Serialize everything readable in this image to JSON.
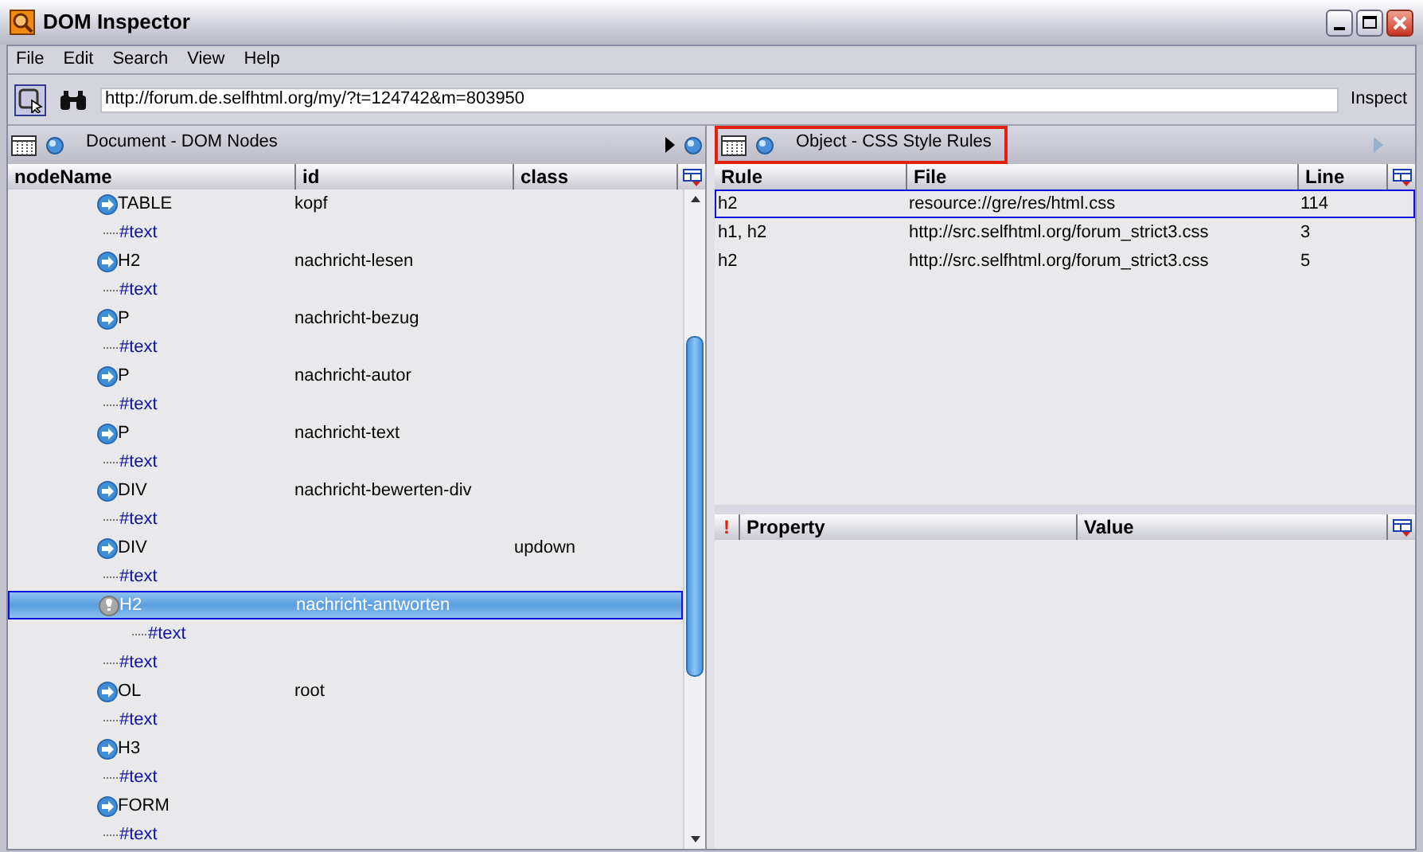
{
  "window": {
    "title": "DOM Inspector"
  },
  "menu": [
    "File",
    "Edit",
    "Search",
    "View",
    "Help"
  ],
  "toolbar": {
    "url": "http://forum.de.selfhtml.org/my/?t=124742&m=803950",
    "inspect_label": "Inspect"
  },
  "left_panel": {
    "title": "Document - DOM Nodes",
    "columns": [
      "nodeName",
      "id",
      "class"
    ],
    "nodes": [
      {
        "kind": "element",
        "name": "TABLE",
        "id": "kopf",
        "selected": false
      },
      {
        "kind": "text",
        "name": "#text",
        "selected": false
      },
      {
        "kind": "element",
        "name": "H2",
        "id": "nachricht-lesen",
        "selected": false
      },
      {
        "kind": "text",
        "name": "#text",
        "selected": false
      },
      {
        "kind": "element",
        "name": "P",
        "id": "nachricht-bezug",
        "selected": false
      },
      {
        "kind": "text",
        "name": "#text",
        "selected": false
      },
      {
        "kind": "element",
        "name": "P",
        "id": "nachricht-autor",
        "selected": false
      },
      {
        "kind": "text",
        "name": "#text",
        "selected": false
      },
      {
        "kind": "element",
        "name": "P",
        "id": "nachricht-text",
        "selected": false
      },
      {
        "kind": "text",
        "name": "#text",
        "selected": false
      },
      {
        "kind": "element",
        "name": "DIV",
        "id": "nachricht-bewerten-div",
        "selected": false
      },
      {
        "kind": "text",
        "name": "#text",
        "selected": false
      },
      {
        "kind": "element",
        "name": "DIV",
        "class": "updown",
        "selected": false
      },
      {
        "kind": "text",
        "name": "#text",
        "selected": false
      },
      {
        "kind": "element",
        "name": "H2",
        "id": "nachricht-antworten",
        "selected": true,
        "children": [
          {
            "kind": "text",
            "name": "#text",
            "selected": false
          }
        ]
      },
      {
        "kind": "text",
        "name": "#text",
        "selected": false
      },
      {
        "kind": "element",
        "name": "OL",
        "id": "root",
        "selected": false
      },
      {
        "kind": "text",
        "name": "#text",
        "selected": false
      },
      {
        "kind": "element",
        "name": "H3",
        "selected": false
      },
      {
        "kind": "text",
        "name": "#text",
        "selected": false
      },
      {
        "kind": "element",
        "name": "FORM",
        "selected": false
      },
      {
        "kind": "text",
        "name": "#text",
        "selected": false
      }
    ]
  },
  "right_panel": {
    "title": "Object - CSS Style Rules",
    "highlighted": true,
    "columns": [
      "Rule",
      "File",
      "Line"
    ],
    "rules": [
      {
        "rule": "h2",
        "file": "resource://gre/res/html.css",
        "line": "114",
        "selected": true
      },
      {
        "rule": "h1, h2",
        "file": "http://src.selfhtml.org/forum_strict3.css",
        "line": "3",
        "selected": false
      },
      {
        "rule": "h2",
        "file": "http://src.selfhtml.org/forum_strict3.css",
        "line": "5",
        "selected": false
      }
    ],
    "property_columns": {
      "important": "!",
      "property": "Property",
      "value": "Value"
    }
  }
}
